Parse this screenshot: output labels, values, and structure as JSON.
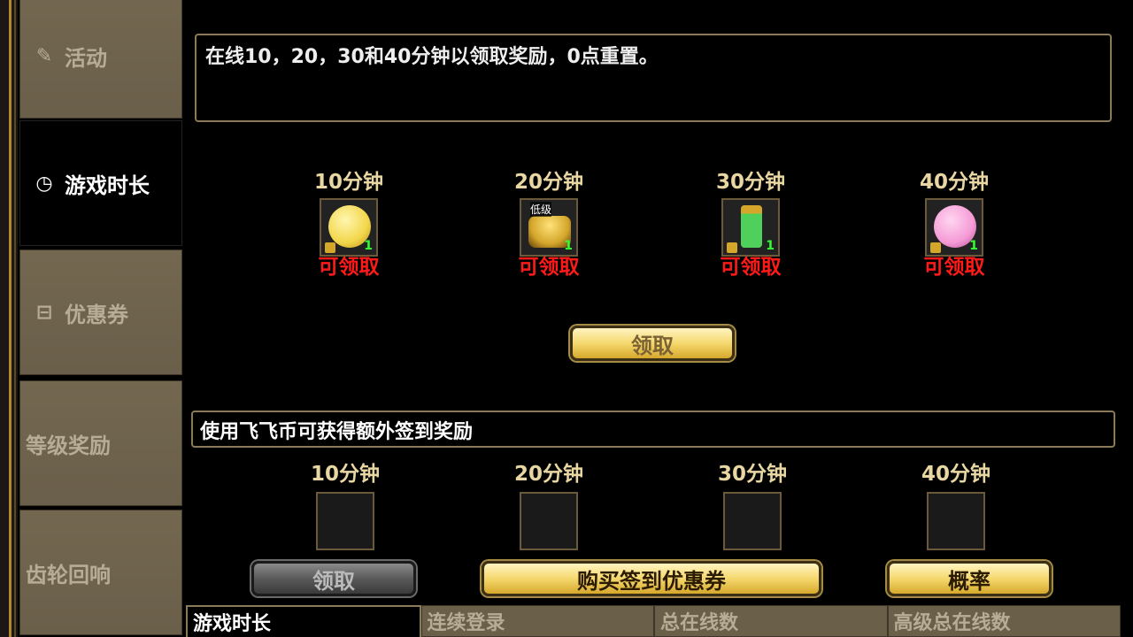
{
  "sidebar": {
    "items": [
      {
        "label": "活动",
        "icon": "ticket-icon"
      },
      {
        "label": "游戏时长",
        "icon": "clock-icon"
      },
      {
        "label": "优惠券",
        "icon": "coupon-icon"
      },
      {
        "label": "等级奖励",
        "icon": ""
      },
      {
        "label": "齿轮回响",
        "icon": ""
      }
    ]
  },
  "main": {
    "description": "在线10，20，30和40分钟以领取奖励，0点重置。",
    "rewards": [
      {
        "time": "10分钟",
        "status": "可领取",
        "count": "1",
        "color": "#f2d64a"
      },
      {
        "time": "20分钟",
        "status": "可领取",
        "count": "1",
        "tag": "低级",
        "color": "#d4a62a"
      },
      {
        "time": "30分钟",
        "status": "可领取",
        "count": "1",
        "color": "#4fd05a"
      },
      {
        "time": "40分钟",
        "status": "可领取",
        "count": "1",
        "color": "#f59ad6"
      }
    ],
    "claim_label": "领取",
    "bonus_text": "使用飞飞币可获得额外签到奖励",
    "bonus_slots": [
      {
        "time": "10分钟"
      },
      {
        "time": "20分钟"
      },
      {
        "time": "30分钟"
      },
      {
        "time": "40分钟"
      }
    ],
    "bonus_claim_label": "领取",
    "buy_coupon_label": "购买签到优惠券",
    "probability_label": "概率"
  },
  "tabs": [
    {
      "label": "游戏时长"
    },
    {
      "label": "连续登录"
    },
    {
      "label": "总在线数"
    },
    {
      "label": "高级总在线数"
    }
  ]
}
